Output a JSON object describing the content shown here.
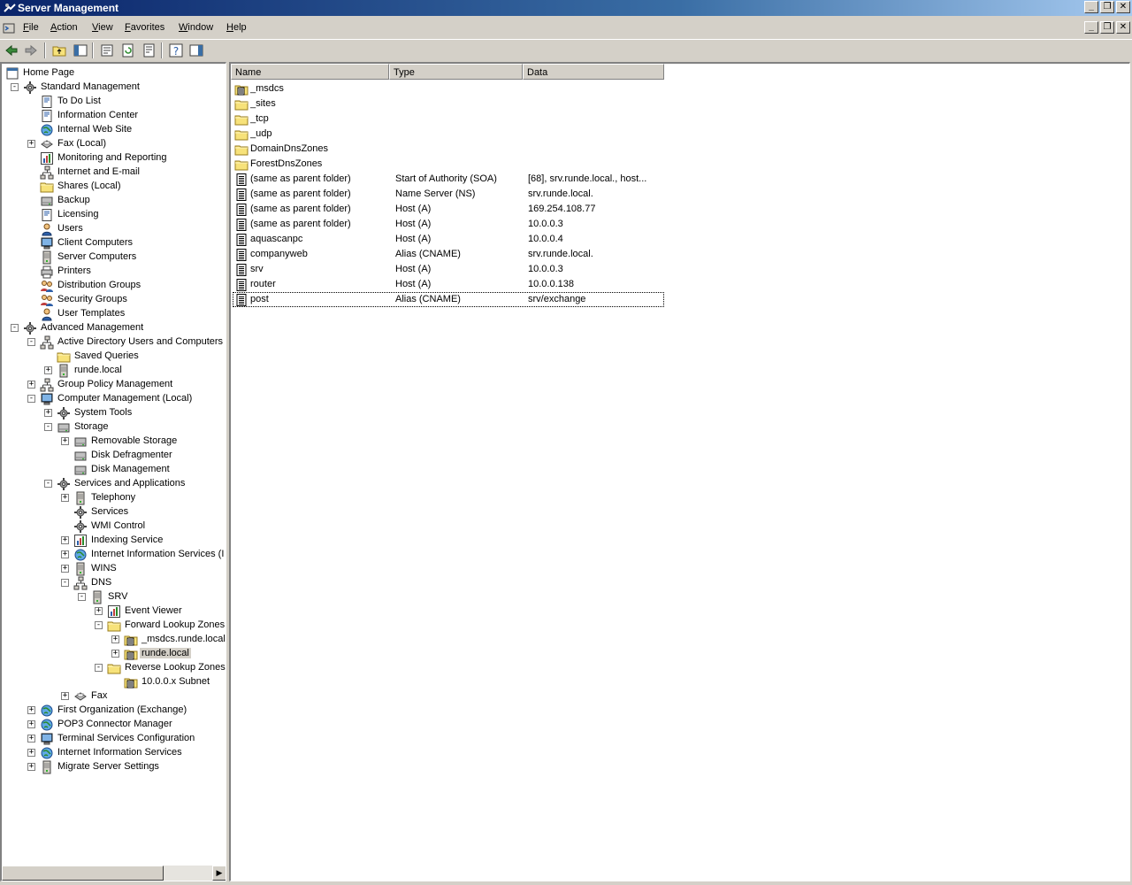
{
  "window": {
    "title": "Server Management",
    "minimize": "_",
    "restore": "❐",
    "close": "✕"
  },
  "menu": [
    "File",
    "Action",
    "View",
    "Favorites",
    "Window",
    "Help"
  ],
  "tree": [
    {
      "label": "Home Page"
    },
    {
      "label": "Standard Management"
    },
    {
      "label": "To Do List"
    },
    {
      "label": "Information Center"
    },
    {
      "label": "Internal Web Site"
    },
    {
      "label": "Fax (Local)"
    },
    {
      "label": "Monitoring and Reporting"
    },
    {
      "label": "Internet and E-mail"
    },
    {
      "label": "Shares (Local)"
    },
    {
      "label": "Backup"
    },
    {
      "label": "Licensing"
    },
    {
      "label": "Users"
    },
    {
      "label": "Client Computers"
    },
    {
      "label": "Server Computers"
    },
    {
      "label": "Printers"
    },
    {
      "label": "Distribution Groups"
    },
    {
      "label": "Security Groups"
    },
    {
      "label": "User Templates"
    },
    {
      "label": "Advanced Management"
    },
    {
      "label": "Active Directory Users and Computers ["
    },
    {
      "label": "Saved Queries"
    },
    {
      "label": "runde.local"
    },
    {
      "label": "Group Policy Management"
    },
    {
      "label": "Computer Management (Local)"
    },
    {
      "label": "System Tools"
    },
    {
      "label": "Storage"
    },
    {
      "label": "Removable Storage"
    },
    {
      "label": "Disk Defragmenter"
    },
    {
      "label": "Disk Management"
    },
    {
      "label": "Services and Applications"
    },
    {
      "label": "Telephony"
    },
    {
      "label": "Services"
    },
    {
      "label": "WMI Control"
    },
    {
      "label": "Indexing Service"
    },
    {
      "label": "Internet Information Services (I"
    },
    {
      "label": "WINS"
    },
    {
      "label": "DNS"
    },
    {
      "label": "SRV"
    },
    {
      "label": "Event Viewer"
    },
    {
      "label": "Forward Lookup Zones"
    },
    {
      "label": "_msdcs.runde.local"
    },
    {
      "label": "runde.local"
    },
    {
      "label": "Reverse Lookup Zones"
    },
    {
      "label": "10.0.0.x Subnet"
    },
    {
      "label": "Fax"
    },
    {
      "label": "First Organization (Exchange)"
    },
    {
      "label": "POP3 Connector Manager"
    },
    {
      "label": "Terminal Services Configuration"
    },
    {
      "label": "Internet Information Services"
    },
    {
      "label": "Migrate Server Settings"
    }
  ],
  "list": {
    "columns": [
      "Name",
      "Type",
      "Data"
    ],
    "rows": [
      {
        "name": "_msdcs",
        "type": "",
        "data": "",
        "icon": "zone-folder-icon"
      },
      {
        "name": "_sites",
        "type": "",
        "data": "",
        "icon": "folder-icon"
      },
      {
        "name": "_tcp",
        "type": "",
        "data": "",
        "icon": "folder-icon"
      },
      {
        "name": "_udp",
        "type": "",
        "data": "",
        "icon": "folder-icon"
      },
      {
        "name": "DomainDnsZones",
        "type": "",
        "data": "",
        "icon": "folder-icon"
      },
      {
        "name": "ForestDnsZones",
        "type": "",
        "data": "",
        "icon": "folder-icon"
      },
      {
        "name": "(same as parent folder)",
        "type": "Start of Authority (SOA)",
        "data": "[68], srv.runde.local., host...",
        "icon": "record-icon"
      },
      {
        "name": "(same as parent folder)",
        "type": "Name Server (NS)",
        "data": "srv.runde.local.",
        "icon": "record-icon"
      },
      {
        "name": "(same as parent folder)",
        "type": "Host (A)",
        "data": "169.254.108.77",
        "icon": "record-icon"
      },
      {
        "name": "(same as parent folder)",
        "type": "Host (A)",
        "data": "10.0.0.3",
        "icon": "record-icon"
      },
      {
        "name": "aquascanpc",
        "type": "Host (A)",
        "data": "10.0.0.4",
        "icon": "record-icon"
      },
      {
        "name": "companyweb",
        "type": "Alias (CNAME)",
        "data": "srv.runde.local.",
        "icon": "record-icon"
      },
      {
        "name": "srv",
        "type": "Host (A)",
        "data": "10.0.0.3",
        "icon": "record-icon"
      },
      {
        "name": "router",
        "type": "Host (A)",
        "data": "10.0.0.138",
        "icon": "record-icon"
      },
      {
        "name": "post",
        "type": "Alias (CNAME)",
        "data": "srv/exchange",
        "icon": "record-icon"
      }
    ]
  }
}
